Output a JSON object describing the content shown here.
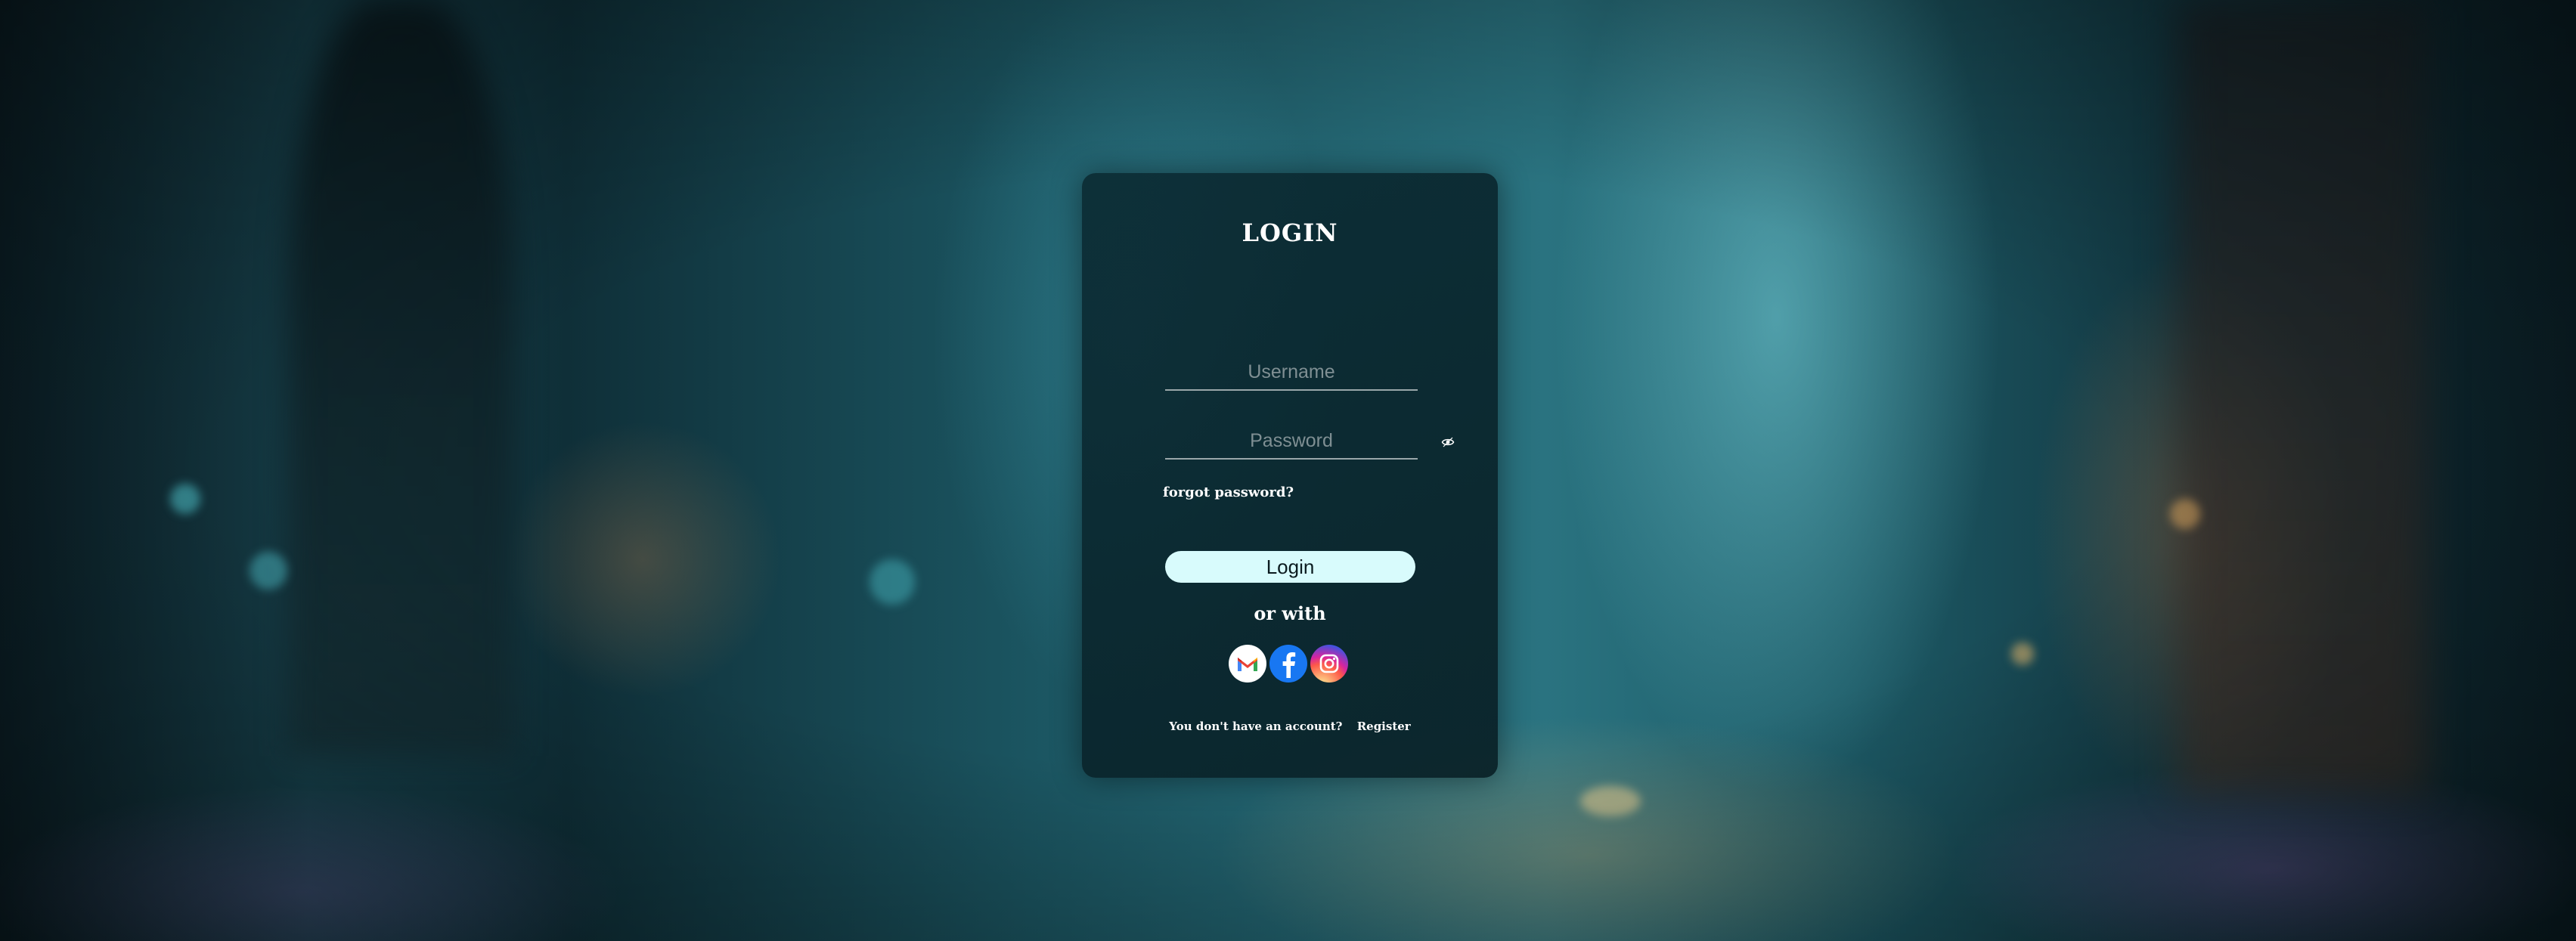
{
  "login_card": {
    "title": "LOGIN",
    "username_placeholder": "Username",
    "password_placeholder": "Password",
    "forgot_password": "forgot password?",
    "login_button": "Login",
    "or_with": "or with",
    "social": [
      {
        "name": "gmail-icon"
      },
      {
        "name": "facebook-icon"
      },
      {
        "name": "instagram-icon"
      }
    ],
    "no_account_text": "You don't have an account?",
    "register_link": "Register"
  },
  "colors": {
    "card_bg": "#0a2830",
    "button_bg": "#d8fbfc",
    "text": "#ffffff"
  }
}
